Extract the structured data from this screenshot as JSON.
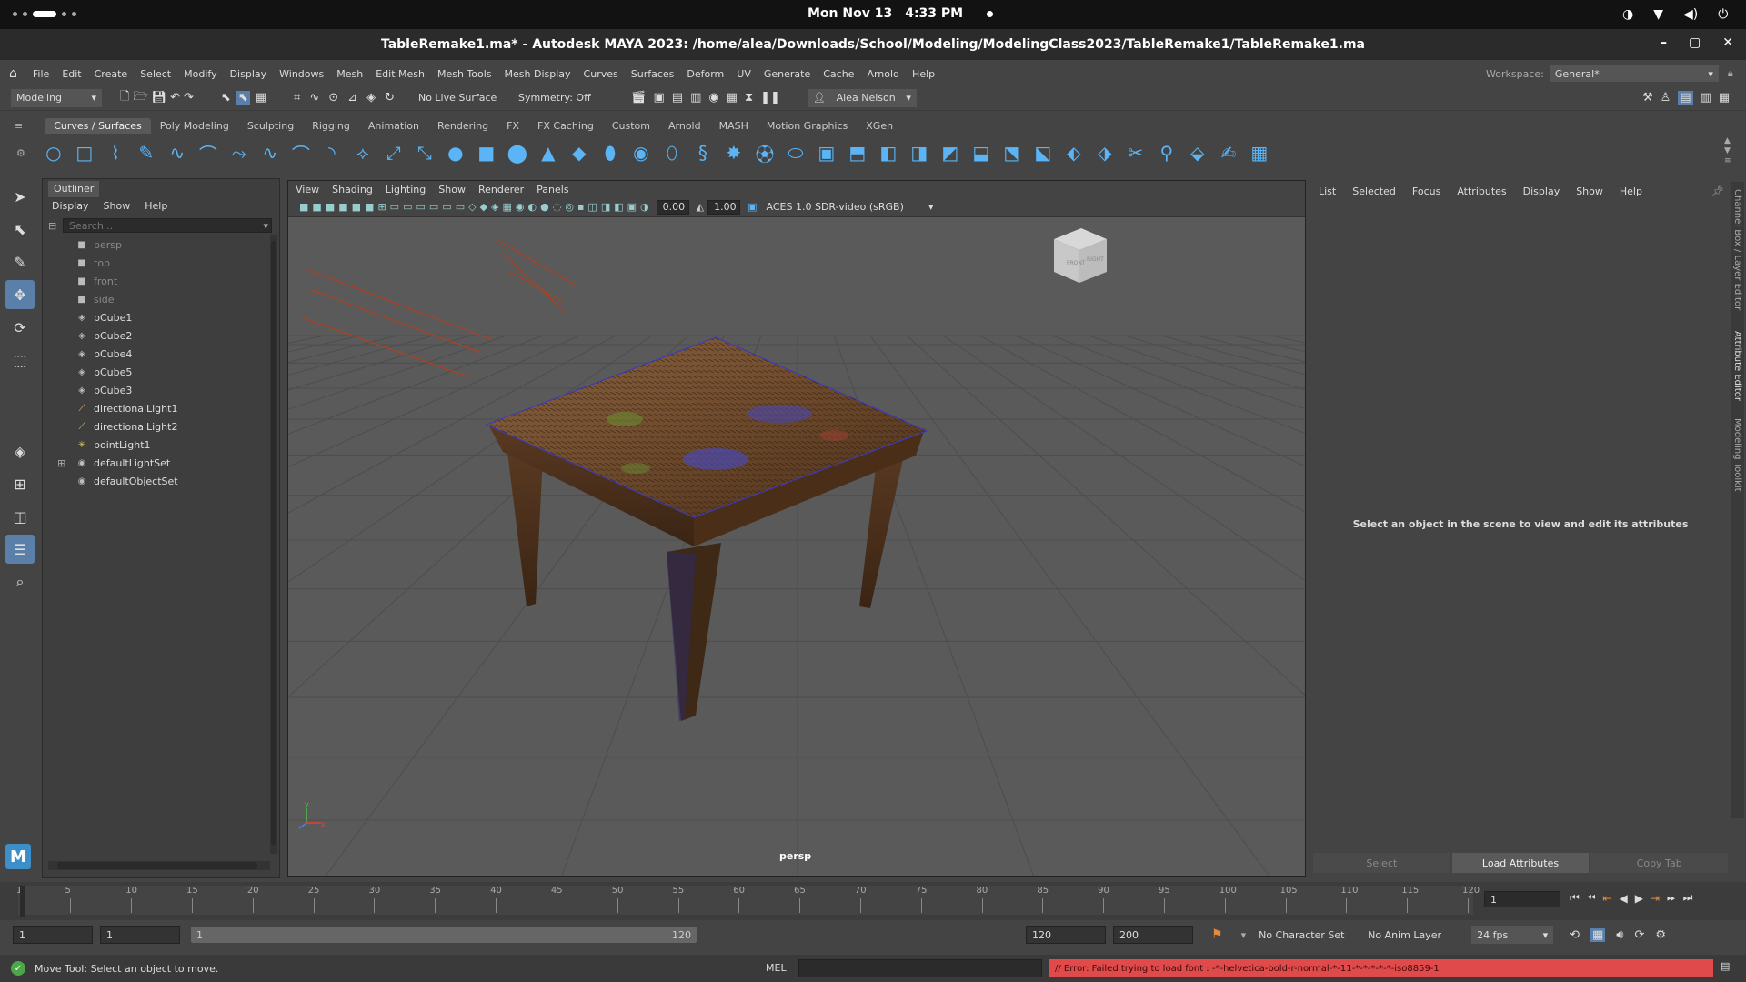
{
  "system_bar": {
    "date": "Mon Nov 13",
    "time": "4:33 PM"
  },
  "window": {
    "title": "TableRemake1.ma* - Autodesk MAYA 2023: /home/alea/Downloads/School/Modeling/ModelingClass2023/TableRemake1/TableRemake1.ma"
  },
  "menu": [
    "File",
    "Edit",
    "Create",
    "Select",
    "Modify",
    "Display",
    "Windows",
    "Mesh",
    "Edit Mesh",
    "Mesh Tools",
    "Mesh Display",
    "Curves",
    "Surfaces",
    "Deform",
    "UV",
    "Generate",
    "Cache",
    "Arnold",
    "Help"
  ],
  "workspace": {
    "label": "Workspace:",
    "value": "General*"
  },
  "status_line": {
    "mode": "Modeling",
    "live_surface": "No Live Surface",
    "symmetry": "Symmetry: Off",
    "user": "Alea Nelson"
  },
  "shelf_tabs": [
    "Curves / Surfaces",
    "Poly Modeling",
    "Sculpting",
    "Rigging",
    "Animation",
    "Rendering",
    "FX",
    "FX Caching",
    "Custom",
    "Arnold",
    "MASH",
    "Motion Graphics",
    "XGen"
  ],
  "shelf_icons": [
    "circle-icon",
    "square-icon",
    "curve-icon",
    "pencil-curve-icon",
    "bezier-icon",
    "arc-icon",
    "curve-tool-icon",
    "ep-curve-icon",
    "arc-tool-icon",
    "revolve-icon",
    "loft-icon",
    "planar-icon",
    "extrude-icon",
    "sphere-icon",
    "cube-icon",
    "cylinder-icon",
    "cone-icon",
    "plane-icon",
    "torus-icon",
    "disk-icon",
    "pipe-icon",
    "helix-icon",
    "gear-icon",
    "soccer-icon",
    "super-ellipse-icon",
    "cube-nurbs-icon",
    "cylinder-nurbs-icon",
    "plane-nurbs-icon",
    "square-nurbs-icon",
    "curve-edit-icon",
    "bevel-icon",
    "bridge-icon",
    "extrude-edge-icon",
    "crease-icon",
    "insert-loop-icon",
    "multi-cut-icon",
    "target-weld-icon",
    "bevel2-icon",
    "sculpt-icon",
    "quad-draw-icon"
  ],
  "outliner": {
    "title": "Outliner",
    "menu": [
      "Display",
      "Show",
      "Help"
    ],
    "search_placeholder": "Search...",
    "items": [
      {
        "label": "persp",
        "icon": "camera-icon",
        "dim": true
      },
      {
        "label": "top",
        "icon": "camera-icon",
        "dim": true
      },
      {
        "label": "front",
        "icon": "camera-icon",
        "dim": true
      },
      {
        "label": "side",
        "icon": "camera-icon",
        "dim": true
      },
      {
        "label": "pCube1",
        "icon": "mesh-icon",
        "dim": false
      },
      {
        "label": "pCube2",
        "icon": "mesh-icon",
        "dim": false
      },
      {
        "label": "pCube4",
        "icon": "mesh-icon",
        "dim": false
      },
      {
        "label": "pCube5",
        "icon": "mesh-icon",
        "dim": false
      },
      {
        "label": "pCube3",
        "icon": "mesh-icon",
        "dim": false
      },
      {
        "label": "directionalLight1",
        "icon": "light-icon",
        "dim": false
      },
      {
        "label": "directionalLight2",
        "icon": "light-icon",
        "dim": false
      },
      {
        "label": "pointLight1",
        "icon": "point-light-icon",
        "dim": false
      },
      {
        "label": "defaultLightSet",
        "icon": "set-icon",
        "dim": false
      },
      {
        "label": "defaultObjectSet",
        "icon": "set-icon",
        "dim": false
      }
    ]
  },
  "viewport": {
    "menu": [
      "View",
      "Shading",
      "Lighting",
      "Show",
      "Renderer",
      "Panels"
    ],
    "near_value": "0.00",
    "far_value": "1.00",
    "color_space": "ACES 1.0 SDR-video (sRGB)",
    "camera_label": "persp"
  },
  "attribute_editor": {
    "menu": [
      "List",
      "Selected",
      "Focus",
      "Attributes",
      "Display",
      "Show",
      "Help"
    ],
    "message": "Select an object in the scene to view and edit its attributes",
    "buttons": [
      "Select",
      "Load Attributes",
      "Copy Tab"
    ],
    "side_tabs": [
      "Channel Box / Layer Editor",
      "Attribute Editor",
      "Modeling Toolkit"
    ]
  },
  "timeline": {
    "ticks": [
      "1",
      "5",
      "10",
      "15",
      "20",
      "25",
      "30",
      "35",
      "40",
      "45",
      "50",
      "55",
      "60",
      "65",
      "70",
      "75",
      "80",
      "85",
      "90",
      "95",
      "100",
      "105",
      "110",
      "115",
      "120"
    ],
    "current_frame": "1"
  },
  "range": {
    "start": "1",
    "start_inner": "1",
    "slider_start": "1",
    "slider_end": "120",
    "end_inner": "120",
    "end": "200",
    "character_set": "No Character Set",
    "anim_layer": "No Anim Layer",
    "fps": "24 fps"
  },
  "help_line": {
    "message": "Move Tool: Select an object to move.",
    "mel_label": "MEL",
    "error": "// Error: Failed trying to load font : -*-helvetica-bold-r-normal-*-11-*-*-*-*-*-iso8859-1"
  },
  "colors": {
    "accent": "#5ab4f5",
    "error_bg": "#e04a4a",
    "viewport_bg": "#5a5a5a"
  }
}
